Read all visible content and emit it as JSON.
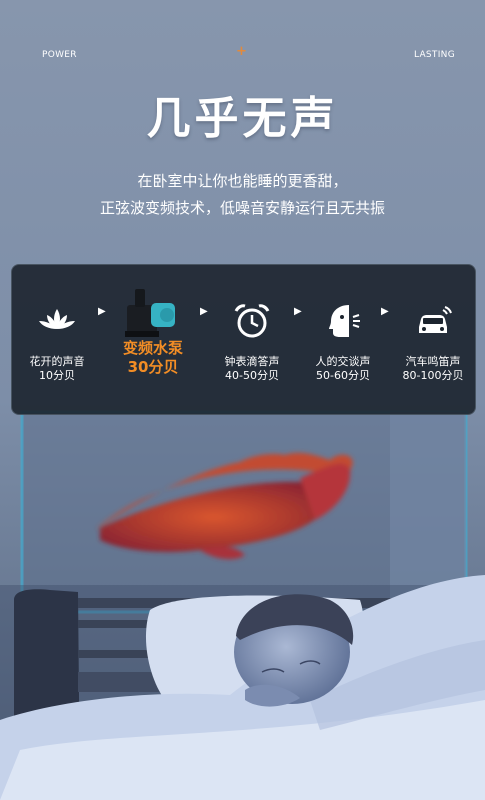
{
  "header": {
    "left_label": "POWER",
    "right_label": "LASTING",
    "title": "几乎无声"
  },
  "subtitle": {
    "line1": "在卧室中让你也能睡的更香甜，",
    "line2": "正弦波变频技术，低噪音安静运行且无共振"
  },
  "comparison": [
    {
      "icon": "lotus-icon",
      "name": "花开的声音",
      "db": "10分贝",
      "highlight": false
    },
    {
      "icon": "water-pump-icon",
      "name": "变频水泵",
      "db": "30分贝",
      "highlight": true
    },
    {
      "icon": "alarm-clock-icon",
      "name": "钟表滴答声",
      "db": "40-50分贝",
      "highlight": false
    },
    {
      "icon": "talking-head-icon",
      "name": "人的交谈声",
      "db": "50-60分贝",
      "highlight": false
    },
    {
      "icon": "car-horn-icon",
      "name": "汽车鸣笛声",
      "db": "80-100分贝",
      "highlight": false
    }
  ],
  "colors": {
    "accent": "#f28d25",
    "panel": "#1c242e"
  }
}
